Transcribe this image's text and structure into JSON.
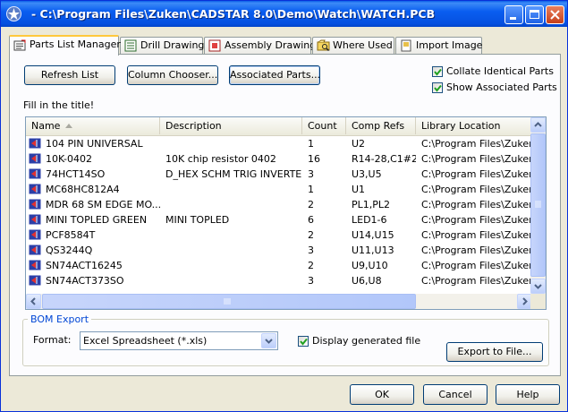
{
  "window": {
    "title": "- C:\\Program Files\\Zuken\\CADSTAR 8.0\\Demo\\Watch\\WATCH.PCB"
  },
  "tabs": [
    {
      "label": "Parts List Manager",
      "icon": "parts-list-icon",
      "active": true
    },
    {
      "label": "Drill Drawing",
      "icon": "drill-drawing-icon",
      "active": false
    },
    {
      "label": "Assembly Drawing",
      "icon": "assembly-drawing-icon",
      "active": false
    },
    {
      "label": "Where Used",
      "icon": "where-used-icon",
      "active": false
    },
    {
      "label": "Import Image",
      "icon": "import-image-icon",
      "active": false
    }
  ],
  "toolbar": {
    "refresh": "Refresh List",
    "column_chooser": "Column Chooser...",
    "associated_parts": "Associated Parts..."
  },
  "options": {
    "collate": {
      "label": "Collate Identical Parts",
      "checked": true
    },
    "show_associated": {
      "label": "Show Associated Parts",
      "checked": true
    }
  },
  "fill_title": "Fill in the title!",
  "table": {
    "columns": [
      "Name",
      "Description",
      "Count",
      "Comp Refs",
      "Library Location"
    ],
    "rows": [
      [
        "104 PIN UNIVERSAL",
        "",
        "1",
        "U2",
        "C:\\Program Files\\Zuken\\CA"
      ],
      [
        "10K-0402",
        "10K chip resistor 0402",
        "16",
        "R14-28,C1#2",
        "C:\\Program Files\\Zuken\\CA"
      ],
      [
        "74HCT14SO",
        "D_HEX SCHM TRIG INVERTERS",
        "3",
        "U3,U5",
        "C:\\Program Files\\Zuken\\CA"
      ],
      [
        "MC68HC812A4",
        "",
        "1",
        "U1",
        "C:\\Program Files\\Zuken\\CA"
      ],
      [
        "MDR 68 SM EDGE MO...",
        "",
        "2",
        "PL1,PL2",
        "C:\\Program Files\\Zuken\\CA"
      ],
      [
        "MINI TOPLED GREEN",
        "MINI TOPLED",
        "6",
        "LED1-6",
        "C:\\Program Files\\Zuken\\CA"
      ],
      [
        "PCF8584T",
        "",
        "2",
        "U14,U15",
        "C:\\Program Files\\Zuken\\CA"
      ],
      [
        "QS3244Q",
        "",
        "3",
        "U11,U13",
        "C:\\Program Files\\Zuken\\CA"
      ],
      [
        "SN74ACT16245",
        "",
        "2",
        "U9,U10",
        "C:\\Program Files\\Zuken\\CA"
      ],
      [
        "SN74ACT373SO",
        "",
        "3",
        "U6,U8",
        "C:\\Program Files\\Zuken\\CA"
      ]
    ]
  },
  "bom": {
    "group_title": "BOM Export",
    "format_label": "Format:",
    "format_value": "Excel Spreadsheet (*.xls)",
    "display_generated": {
      "label": "Display generated file",
      "checked": true
    },
    "export_button": "Export to File..."
  },
  "footer": {
    "ok": "OK",
    "cancel": "Cancel",
    "help": "Help"
  }
}
